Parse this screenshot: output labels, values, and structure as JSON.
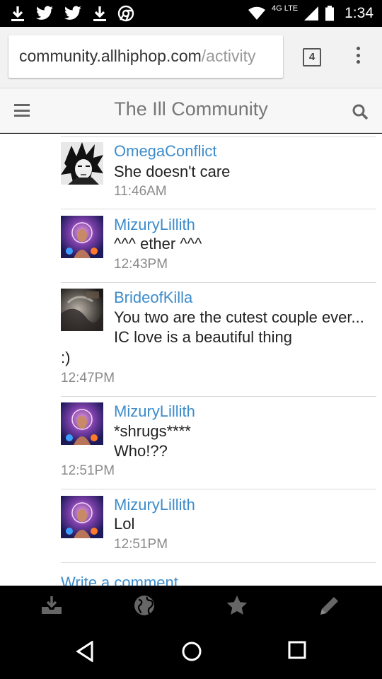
{
  "status_bar": {
    "time": "1:34",
    "network": "4G LTE",
    "icons": [
      "download-icon",
      "twitter-icon",
      "twitter-icon",
      "download-icon",
      "chrome-icon",
      "wifi-icon",
      "signal-icon",
      "battery-icon"
    ]
  },
  "browser": {
    "url_domain": "community.allhiphop.com",
    "url_path": "/activity",
    "tab_count": "4"
  },
  "site": {
    "title": "The Ill Community"
  },
  "comments": [
    {
      "author": "OmegaConflict",
      "lines": [
        "She doesn't care"
      ],
      "trailing": "",
      "time": "11:46AM",
      "avatar": "goku"
    },
    {
      "author": "MizuryLillith",
      "lines": [
        "^^^ ether ^^^"
      ],
      "trailing": "",
      "time": "12:43PM",
      "avatar": "goddess"
    },
    {
      "author": "BrideofKilla",
      "lines": [
        "You two are the cutest couple ever...",
        "IC love is a beautiful thing"
      ],
      "trailing": ":)",
      "time": "12:47PM",
      "avatar": "smoke"
    },
    {
      "author": "MizuryLillith",
      "lines": [
        "*shrugs****",
        "Who!??"
      ],
      "trailing": "",
      "time": "12:51PM",
      "avatar": "goddess"
    },
    {
      "author": "MizuryLillith",
      "lines": [
        "Lol"
      ],
      "trailing": "",
      "time": "12:51PM",
      "avatar": "goddess"
    }
  ],
  "write_comment": "Write a comment",
  "app_bar": [
    "inbox-download-icon",
    "globe-icon",
    "star-icon",
    "pencil-icon"
  ],
  "nav_bar": [
    "back-icon",
    "home-icon",
    "recents-icon"
  ],
  "colors": {
    "link": "#3d8ccb",
    "status_bar": "#000000",
    "toolbar": "#f2f2f2"
  }
}
